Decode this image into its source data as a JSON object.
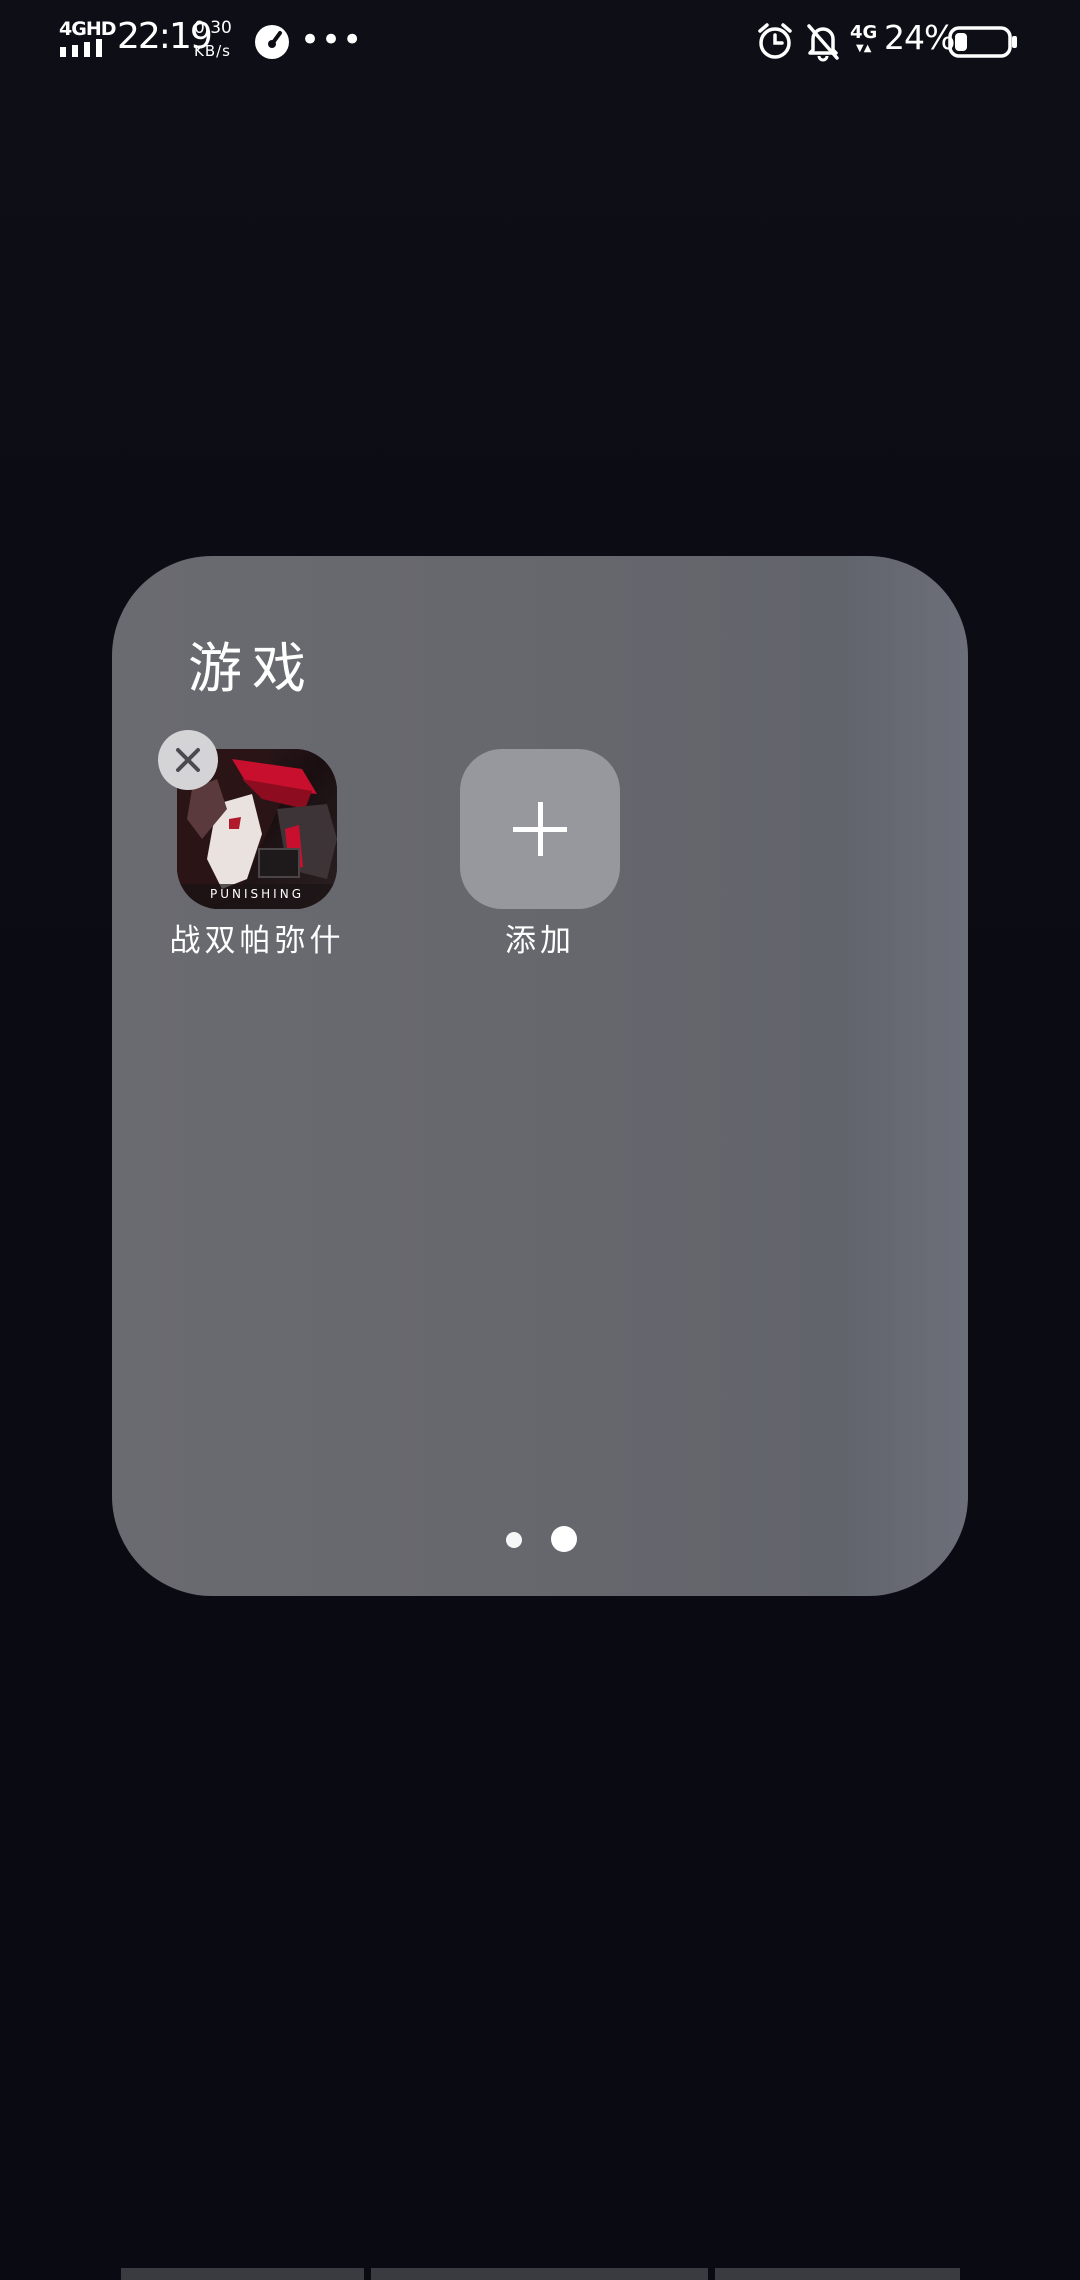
{
  "status_bar": {
    "network_type": "4GHD",
    "time": "22:19",
    "speed_value": "0.30",
    "speed_unit": "KB/s",
    "more_indicator": "•••",
    "cellular_badge": "4G",
    "cellular_arrows": "▼▲",
    "battery_percent": "24%",
    "battery_level": 0.24,
    "icons": [
      "signal-bars-icon",
      "speedometer-icon",
      "more-icon",
      "alarm-clock-icon",
      "bell-off-icon",
      "4g-data-icon",
      "battery-icon"
    ]
  },
  "folder": {
    "title": "游戏",
    "apps": [
      {
        "label": "战双帕弥什",
        "icon_text": "PUNISHING",
        "icon": "app-game-icon",
        "removable": true
      },
      {
        "label": "添加",
        "icon": "plus-icon"
      }
    ],
    "page_count": 2,
    "current_page": 2
  },
  "colors": {
    "background": "#0d0d14",
    "folder_background": "#67686e",
    "add_tile": "#97989d",
    "remove_badge": "#d4d4d7",
    "game_accent": "#c8102e"
  }
}
